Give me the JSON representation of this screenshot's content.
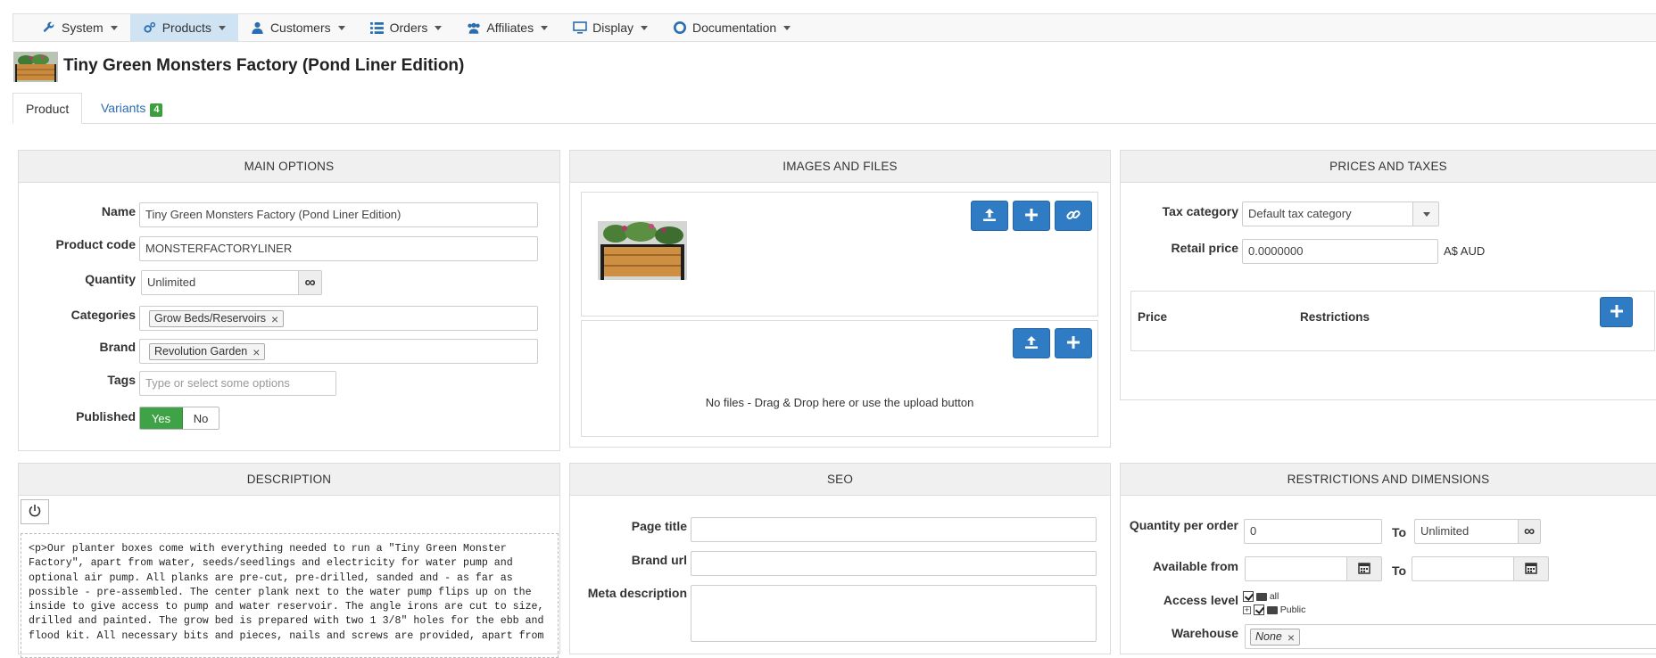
{
  "nav": {
    "items": [
      {
        "label": "System",
        "icon": "wrench-icon"
      },
      {
        "label": "Products",
        "icon": "cogs-icon"
      },
      {
        "label": "Customers",
        "icon": "user-icon"
      },
      {
        "label": "Orders",
        "icon": "list-icon"
      },
      {
        "label": "Affiliates",
        "icon": "users-icon"
      },
      {
        "label": "Display",
        "icon": "monitor-icon"
      },
      {
        "label": "Documentation",
        "icon": "lifebuoy-icon"
      }
    ],
    "active": "Products"
  },
  "header": {
    "title": "Tiny Green Monsters Factory (Pond Liner Edition)"
  },
  "tabs": [
    {
      "label": "Product"
    },
    {
      "label": "Variants",
      "badge": "4"
    }
  ],
  "main_options": {
    "heading": "MAIN OPTIONS",
    "name_label": "Name",
    "name_value": "Tiny Green Monsters Factory (Pond Liner Edition)",
    "code_label": "Product code",
    "code_value": "MONSTERFACTORYLINER",
    "quantity_label": "Quantity",
    "quantity_value": "Unlimited",
    "categories_label": "Categories",
    "category_tag": "Grow Beds/Reservoirs",
    "brand_label": "Brand",
    "brand_tag": "Revolution Garden",
    "tags_label": "Tags",
    "tags_placeholder": "Type or select some options",
    "published_label": "Published",
    "yes": "Yes",
    "no": "No"
  },
  "images": {
    "heading": "IMAGES AND FILES",
    "empty_text": "No files - Drag & Drop here or use the upload button"
  },
  "prices": {
    "heading": "PRICES AND TAXES",
    "tax_label": "Tax category",
    "tax_value": "Default tax category",
    "retail_label": "Retail price",
    "retail_value": "0.0000000",
    "currency": "A$ AUD",
    "col_price": "Price",
    "col_restrictions": "Restrictions"
  },
  "description": {
    "heading": "DESCRIPTION",
    "text": "<p>Our planter boxes come with everything needed to run a \"Tiny Green Monster\nFactory\", apart from water, seeds/seedlings and electricity for water pump and\noptional air pump. All planks are pre-cut, pre-drilled, sanded and - as far as\npossible - pre-assembled. The center plank next to the water pump flips up on the\ninside to give access to pump and water reservoir. The angle irons are cut to size,\ndrilled and painted. The grow bed is prepared with two 1 3/8\" holes for the ebb and\nflood kit. All necessary bits and pieces, nails and screws are provided, apart from"
  },
  "seo": {
    "heading": "SEO",
    "page_title_label": "Page title",
    "brand_url_label": "Brand url",
    "meta_label": "Meta description"
  },
  "restrictions": {
    "heading": "RESTRICTIONS AND DIMENSIONS",
    "qpo_label": "Quantity per order",
    "qpo_value": "0",
    "to_label": "To",
    "qpo_to_value": "Unlimited",
    "available_label": "Available from",
    "to2_label": "To",
    "access_label": "Access level",
    "access_all": "all",
    "access_public": "Public",
    "warehouse_label": "Warehouse",
    "warehouse_tag": "None"
  },
  "colors": {
    "accent": "#2f7bc4",
    "success": "#3ea346",
    "nav_active": "#cfe3f3"
  }
}
